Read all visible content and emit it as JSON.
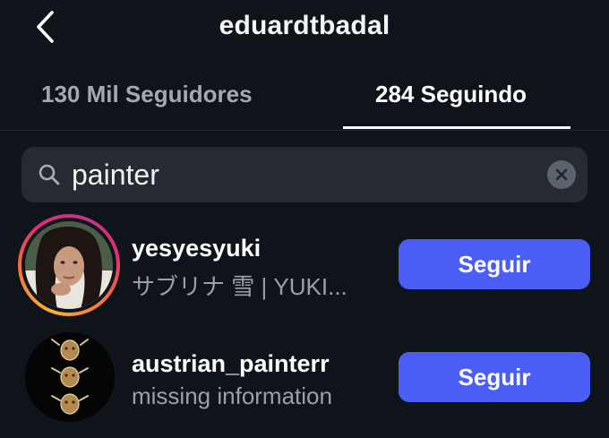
{
  "header": {
    "title": "eduardtbadal",
    "back_icon": "chevron-left-icon"
  },
  "tabs": [
    {
      "label": "130 Mil Seguidores",
      "active": false
    },
    {
      "label": "284 Seguindo",
      "active": true
    }
  ],
  "search": {
    "value": "painter",
    "icon": "search-icon",
    "clear_icon": "clear-icon"
  },
  "results": [
    {
      "username": "yesyesyuki",
      "subtitle": "サブリナ 雪 | YUKI...",
      "button_label": "Seguir",
      "has_story_ring": true
    },
    {
      "username": "austrian_painterr",
      "subtitle": "missing information",
      "button_label": "Seguir",
      "has_story_ring": false
    }
  ],
  "colors": {
    "background": "#0f141b",
    "search_bg": "#262b33",
    "button": "#4a5ef6",
    "muted_text": "#9aa0a8"
  }
}
